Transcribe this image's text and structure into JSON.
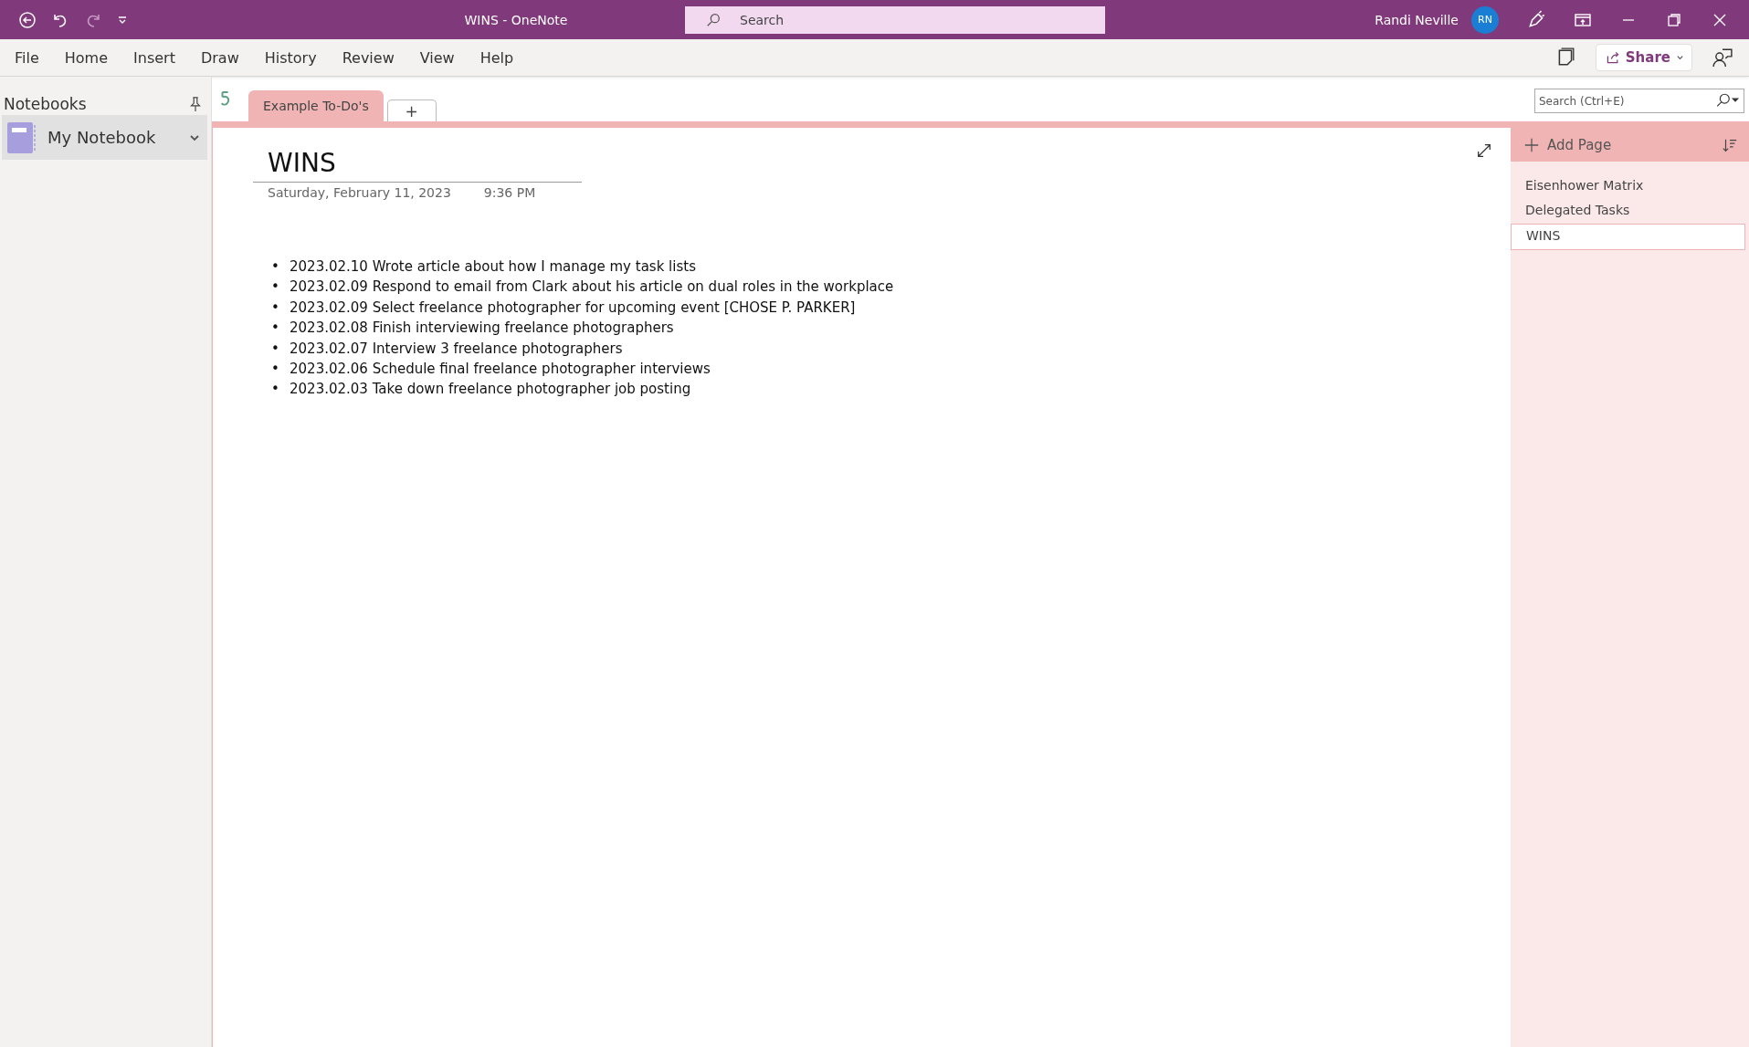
{
  "window": {
    "title": "WINS  -  OneNote"
  },
  "search": {
    "placeholder": "Search"
  },
  "user": {
    "name": "Randi Neville",
    "initials": "RN"
  },
  "menu": [
    {
      "label": "File"
    },
    {
      "label": "Home"
    },
    {
      "label": "Insert"
    },
    {
      "label": "Draw"
    },
    {
      "label": "History"
    },
    {
      "label": "Review"
    },
    {
      "label": "View"
    },
    {
      "label": "Help"
    }
  ],
  "share": {
    "label": "Share"
  },
  "sidebar": {
    "title": "Notebooks",
    "items": [
      {
        "label": "My Notebook",
        "selected": true
      }
    ]
  },
  "sections": [
    {
      "label": "Example To-Do's",
      "selected": true
    }
  ],
  "add_section": {
    "label": "+"
  },
  "page_search": {
    "placeholder": "Search (Ctrl+E)"
  },
  "page": {
    "title": "WINS",
    "marker": "•",
    "date": "Saturday, February 11, 2023",
    "time": "9:36 PM",
    "bullets": [
      "2023.02.10 Wrote article about how I manage my task lists",
      "2023.02.09 Respond to email from Clark about his article on dual roles in the workplace",
      "2023.02.09 Select freelance photographer for upcoming event [CHOSE P. PARKER]",
      "2023.02.08 Finish interviewing freelance photographers",
      "2023.02.07 Interview 3 freelance photographers",
      "2023.02.06 Schedule final freelance photographer interviews",
      "2023.02.03 Take down freelance photographer job posting"
    ]
  },
  "pages_panel": {
    "add_label": "Add Page",
    "pages": [
      {
        "label": "Eisenhower Matrix",
        "selected": false
      },
      {
        "label": "Delegated Tasks",
        "selected": false
      },
      {
        "label": "WINS",
        "selected": true
      }
    ]
  }
}
